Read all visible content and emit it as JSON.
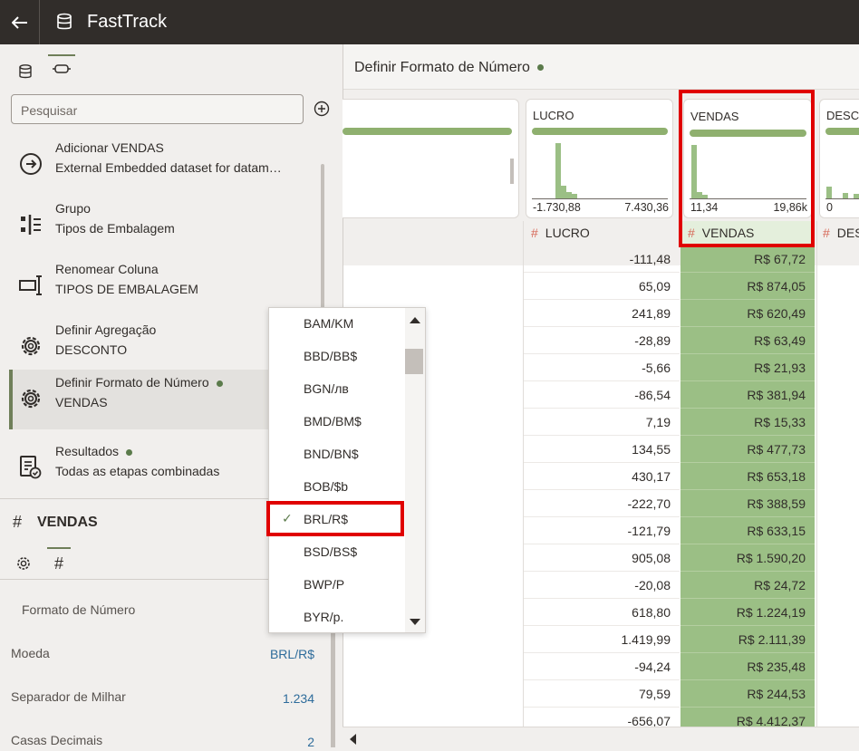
{
  "app": {
    "title": "FastTrack",
    "back_icon": "back-arrow-icon",
    "db_icon": "database-icon"
  },
  "left_panel": {
    "search_placeholder": "Pesquisar",
    "steps": [
      {
        "title": "Adicionar VENDAS",
        "subtitle": "External Embedded dataset for datam…",
        "icon": "add-circle-icon",
        "active": false,
        "dot": false
      },
      {
        "title": "Grupo",
        "subtitle": "Tipos de Embalagem",
        "icon": "group-icon",
        "active": false,
        "dot": false
      },
      {
        "title": "Renomear Coluna",
        "subtitle": "TIPOS DE EMBALAGEM",
        "icon": "rename-column-icon",
        "active": false,
        "dot": false
      },
      {
        "title": "Definir Agregação",
        "subtitle": "DESCONTO",
        "icon": "gear-icon",
        "active": false,
        "dot": false
      },
      {
        "title": "Definir Formato de Número",
        "subtitle": "VENDAS",
        "icon": "gear-icon",
        "active": true,
        "dot": true
      },
      {
        "title": "Resultados",
        "subtitle": "Todas as etapas combinadas",
        "icon": "results-icon",
        "active": false,
        "dot": true
      }
    ],
    "column_hash": "#",
    "column_name": "VENDAS",
    "props_tab_hash": "#",
    "props": {
      "section_title": "Formato de Número",
      "rows": [
        {
          "label": "Moeda",
          "value": "BRL/R$"
        },
        {
          "label": "Separador de Milhar",
          "value": "1.234"
        },
        {
          "label": "Casas Decimais",
          "value": "2"
        }
      ]
    }
  },
  "right_panel": {
    "header_title": "Definir Formato de Número",
    "cards": [
      {
        "name": "LUCRO",
        "min": "-1.730,88",
        "max": "7.430,36"
      },
      {
        "name": "VENDAS",
        "min": "11,34",
        "max": "19,86k"
      },
      {
        "name": "DESCO",
        "min": "0",
        "max": ""
      }
    ],
    "columns": [
      {
        "hash": "#",
        "name": "LUCRO"
      },
      {
        "hash": "#",
        "name": "VENDAS"
      },
      {
        "hash": "#",
        "name": "DES"
      }
    ],
    "lucro": [
      "-111,48",
      "65,09",
      "241,89",
      "-28,89",
      "-5,66",
      "-86,54",
      "7,19",
      "134,55",
      "430,17",
      "-222,70",
      "-121,79",
      "905,08",
      "-20,08",
      "618,80",
      "1.419,99",
      "-94,24",
      "79,59",
      "-656,07"
    ],
    "vendas": [
      "R$ 67,72",
      "R$ 874,05",
      "R$ 620,49",
      "R$ 63,49",
      "R$ 21,93",
      "R$ 381,94",
      "R$ 15,33",
      "R$ 477,73",
      "R$ 653,18",
      "R$ 388,59",
      "R$ 633,15",
      "R$ 1.590,20",
      "R$ 24,72",
      "R$ 1.224,19",
      "R$ 2.111,39",
      "R$ 235,48",
      "R$ 244,53",
      "R$ 4.412,37"
    ]
  },
  "dropdown": {
    "options": [
      "BAM/KM",
      "BBD/BB$",
      "BGN/лв",
      "BMD/BM$",
      "BND/BN$",
      "BOB/$b",
      "BRL/R$",
      "BSD/BS$",
      "BWP/P",
      "BYR/p."
    ],
    "selected": "BRL/R$",
    "check": "✓"
  },
  "colors": {
    "accent": "#6f7f59",
    "highlight": "#e00000",
    "green_fill": "#9bbf85",
    "link": "#2e6c9b",
    "topbar": "#312d2a"
  }
}
